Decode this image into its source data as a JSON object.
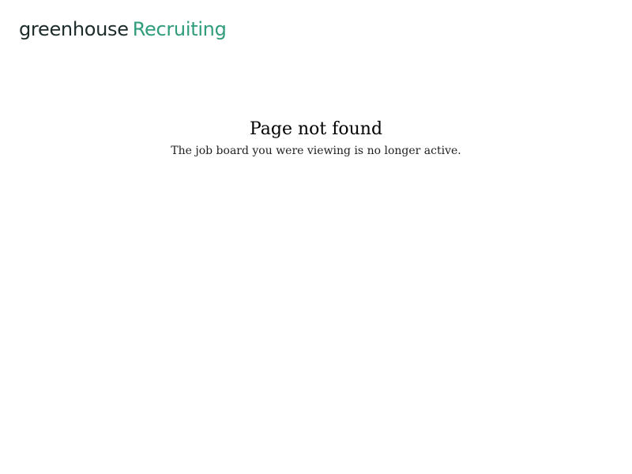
{
  "header": {
    "logo": {
      "brand": "greenhouse",
      "product": "Recruiting"
    }
  },
  "main": {
    "title": "Page not found",
    "message": "The job board you were viewing is no longer active."
  },
  "colors": {
    "brand_dark": "#1d2b2b",
    "brand_green": "#2f9c7b",
    "text": "#000000",
    "background": "#ffffff"
  }
}
